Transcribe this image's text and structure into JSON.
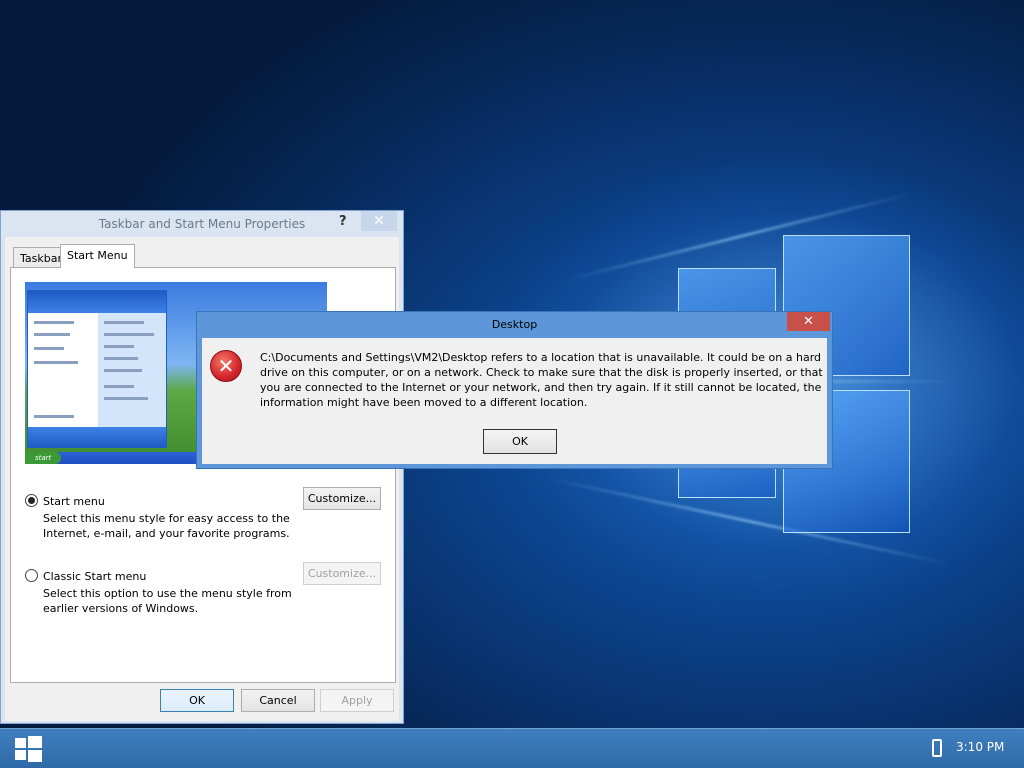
{
  "taskbar": {
    "start_icon": "windows-logo-icon",
    "tray_icon": "usb-drive-icon",
    "clock": "3:10 PM"
  },
  "props_window": {
    "title": "Taskbar and Start Menu Properties",
    "help": "?",
    "close": "✕",
    "tabs": [
      "Taskbar",
      "Start Menu"
    ],
    "active_tab": "Start Menu",
    "preview": {
      "start_label": "start"
    },
    "options": [
      {
        "label": "Start menu",
        "desc": "Select this menu style for easy access to the Internet, e-mail, and your favorite programs.",
        "selected": true,
        "button": "Customize...",
        "button_enabled": true
      },
      {
        "label": "Classic Start menu",
        "desc": "Select this option to use the menu style from earlier versions of Windows.",
        "selected": false,
        "button": "Customize...",
        "button_enabled": false
      }
    ],
    "buttons": {
      "ok": "OK",
      "cancel": "Cancel",
      "apply": "Apply"
    }
  },
  "error_dialog": {
    "title": "Desktop",
    "close": "✕",
    "icon": "error-icon",
    "message": "C:\\Documents and Settings\\VM2\\Desktop refers to a location that is unavailable. It could be on a hard drive on this computer, or on a network. Check to make sure that the disk is properly inserted, or that you are connected to the Internet or your network, and then try again. If it still cannot be located, the information might have been moved to a different location.",
    "ok": "OK"
  },
  "colors": {
    "desktop_blue": "#0b3f86",
    "taskbar": "#3a76b6",
    "dialog_frame": "#5d97d9",
    "close_red": "#c7504a"
  }
}
